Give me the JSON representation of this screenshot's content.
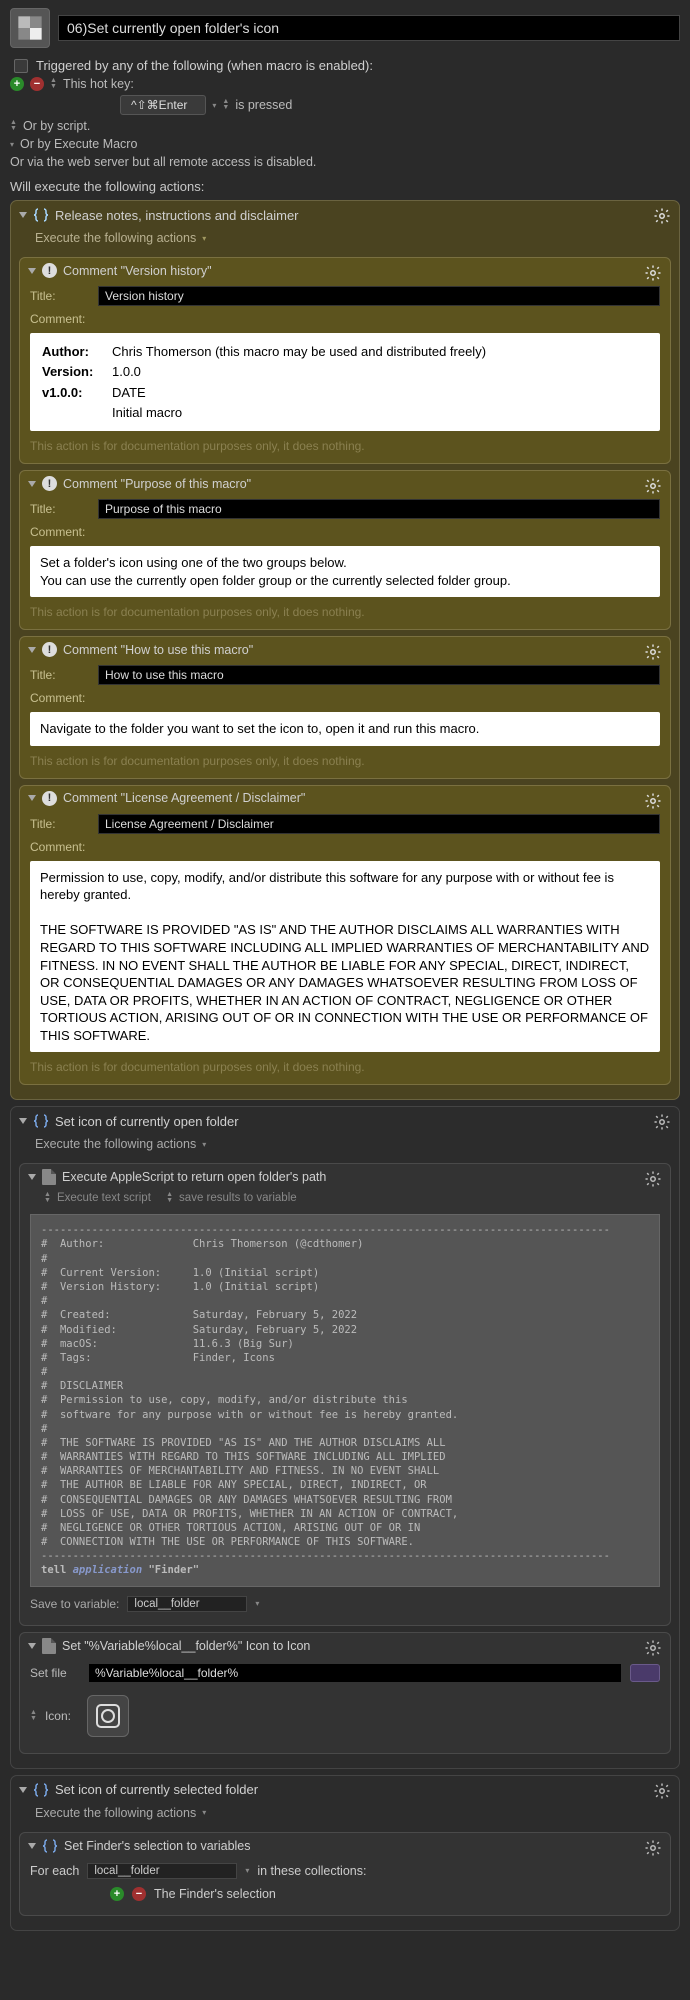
{
  "header": {
    "macro_title": "06)Set currently open folder's icon"
  },
  "trigger": {
    "label": "Triggered by any of the following (when macro is enabled):",
    "hotkey_label": "This hot key:",
    "hotkey_value": "^⇧⌘Enter",
    "hotkey_state": "is pressed",
    "or_script": "Or by script.",
    "or_execute": "Or by Execute Macro",
    "or_web": "Or via the web server but all remote access is disabled.",
    "will_execute": "Will execute the following actions:"
  },
  "group1": {
    "title": "Release notes, instructions and disclaimer",
    "subhead": "Execute the following actions",
    "comments": [
      {
        "header": "Comment \"Version history\"",
        "title_label": "Title:",
        "title_value": "Version history",
        "comment_label": "Comment:",
        "rows": [
          [
            "Author:",
            "Chris Thomerson (this macro may be used and distributed freely)"
          ],
          [
            "Version:",
            "1.0.0"
          ],
          [
            "",
            ""
          ],
          [
            "v1.0.0:",
            "DATE"
          ],
          [
            "",
            "Initial macro"
          ]
        ],
        "foot": "This action is for documentation purposes only, it does nothing."
      },
      {
        "header": "Comment \"Purpose of this macro\"",
        "title_label": "Title:",
        "title_value": "Purpose of this macro",
        "comment_label": "Comment:",
        "body": "Set a folder's icon using one of the two groups below.\nYou can use the currently open folder group or the currently selected folder group.",
        "foot": "This action is for documentation purposes only, it does nothing."
      },
      {
        "header": "Comment \"How to use this macro\"",
        "title_label": "Title:",
        "title_value": "How to use this macro",
        "comment_label": "Comment:",
        "body": "Navigate to the folder you want to set the icon to, open it and run this macro.",
        "foot": "This action is for documentation purposes only, it does nothing."
      },
      {
        "header": "Comment \"License Agreement / Disclaimer\"",
        "title_label": "Title:",
        "title_value": "License Agreement / Disclaimer",
        "comment_label": "Comment:",
        "body": "Permission to use, copy, modify, and/or distribute this software for any purpose with or without fee is hereby granted.\n\nTHE SOFTWARE IS PROVIDED \"AS IS\" AND THE AUTHOR DISCLAIMS ALL WARRANTIES WITH REGARD TO THIS SOFTWARE INCLUDING ALL IMPLIED WARRANTIES OF MERCHANTABILITY AND FITNESS. IN NO EVENT SHALL THE AUTHOR BE LIABLE FOR ANY SPECIAL, DIRECT, INDIRECT, OR CONSEQUENTIAL DAMAGES OR ANY DAMAGES WHATSOEVER RESULTING FROM LOSS OF USE, DATA OR PROFITS, WHETHER IN AN ACTION OF CONTRACT, NEGLIGENCE OR OTHER TORTIOUS ACTION, ARISING OUT OF OR IN CONNECTION WITH THE USE OR PERFORMANCE OF THIS SOFTWARE.",
        "foot": "This action is for documentation purposes only, it does nothing."
      }
    ]
  },
  "group2": {
    "title": "Set icon of currently open folder",
    "subhead": "Execute the following actions",
    "applescript": {
      "header": "Execute AppleScript to return open folder's path",
      "sub_left": "Execute text script",
      "sub_right": "save results to variable",
      "code": "------------------------------------------------------------------------------------------\n#  Author:              Chris Thomerson (@cdthomer)\n#\n#  Current Version:     1.0 (Initial script)\n#  Version History:     1.0 (Initial script)\n#\n#  Created:             Saturday, February 5, 2022\n#  Modified:            Saturday, February 5, 2022\n#  macOS:               11.6.3 (Big Sur)\n#  Tags:                Finder, Icons\n#\n#  DISCLAIMER\n#  Permission to use, copy, modify, and/or distribute this\n#  software for any purpose with or without fee is hereby granted.\n#\n#  THE SOFTWARE IS PROVIDED \"AS IS\" AND THE AUTHOR DISCLAIMS ALL\n#  WARRANTIES WITH REGARD TO THIS SOFTWARE INCLUDING ALL IMPLIED\n#  WARRANTIES OF MERCHANTABILITY AND FITNESS. IN NO EVENT SHALL\n#  THE AUTHOR BE LIABLE FOR ANY SPECIAL, DIRECT, INDIRECT, OR\n#  CONSEQUENTIAL DAMAGES OR ANY DAMAGES WHATSOEVER RESULTING FROM\n#  LOSS OF USE, DATA OR PROFITS, WHETHER IN AN ACTION OF CONTRACT,\n#  NEGLIGENCE OR OTHER TORTIOUS ACTION, ARISING OUT OF OR IN\n#  CONNECTION WITH THE USE OR PERFORMANCE OF THIS SOFTWARE.\n------------------------------------------------------------------------------------------\n",
      "tell_prefix": "tell ",
      "tell_kw": "application",
      "tell_suffix": " \"Finder\"",
      "save_label": "Save to variable:",
      "save_value": "local__folder"
    },
    "seticon": {
      "header": "Set \"%Variable%local__folder%\" Icon to Icon",
      "setfile_label": "Set file",
      "setfile_value": "%Variable%local__folder%",
      "icon_label": "Icon:"
    }
  },
  "group3": {
    "title": "Set icon of currently selected folder",
    "subhead": "Execute the following actions",
    "inner": {
      "title": "Set Finder's selection to variables",
      "foreach_label": "For each",
      "foreach_var": "local__folder",
      "foreach_suffix": "in these collections:",
      "selection_label": "The Finder's selection"
    }
  }
}
